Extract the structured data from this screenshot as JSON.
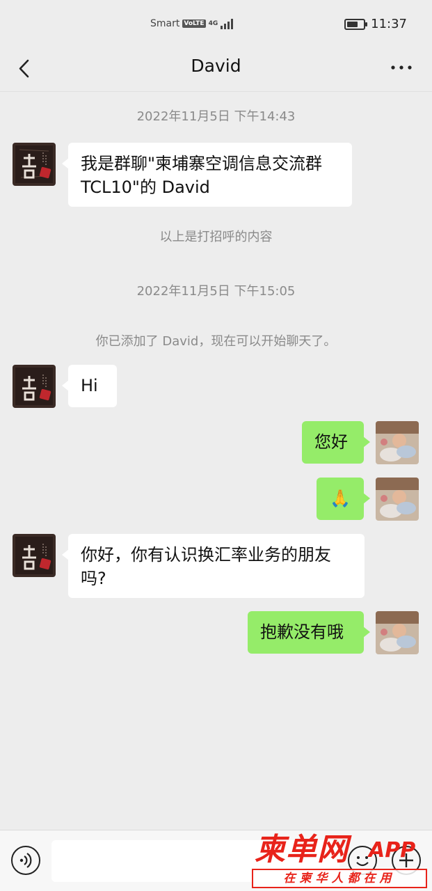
{
  "status_bar": {
    "carrier": "Smart",
    "volte_badge": "VoLTE",
    "network": "4G",
    "time": "11:37",
    "battery_level": 0.7
  },
  "header": {
    "title": "David",
    "back_icon": "chevron-left-icon",
    "more_icon": "more-dots-icon"
  },
  "messages": {
    "timestamp_1": "2022年11月5日 下午14:43",
    "greeting_line1": "我是群聊\"柬埔寨空调信息交流群",
    "greeting_line2": "TCL10\"的 David",
    "system_greeting_note": "以上是打招呼的内容",
    "timestamp_2": "2022年11月5日 下午15:05",
    "system_added_note": "你已添加了 David，现在可以开始聊天了。",
    "msg_hi": "Hi",
    "msg_hello": "您好",
    "msg_pray_emoji": "🙏",
    "msg_question_line1": "你好，你有认识换汇率业务的朋友",
    "msg_question_line2": "吗?",
    "msg_sorry": "抱歉没有哦"
  },
  "input_bar": {
    "voice_icon": "voice-icon",
    "emoji_icon": "emoji-icon",
    "plus_icon": "plus-icon",
    "message_value": ""
  },
  "watermark": {
    "main": "柬单网",
    "app": "APP",
    "slogan": "在柬华人都在用"
  },
  "colors": {
    "background": "#ededed",
    "outgoing_bubble": "#95ec69",
    "incoming_bubble": "#ffffff",
    "watermark_red": "#e8231a"
  }
}
